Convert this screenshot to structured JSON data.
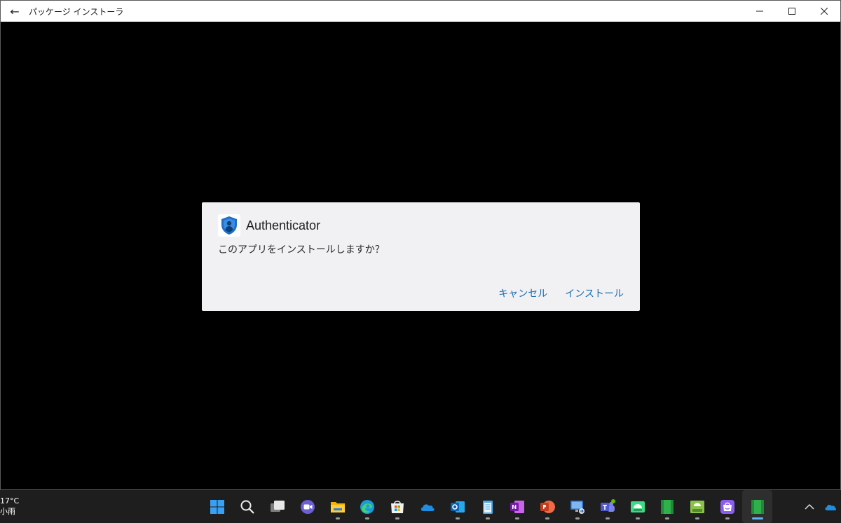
{
  "window": {
    "title": "パッケージ インストーラ",
    "back_glyph": "←",
    "minimize_glyph": "—",
    "maximize_glyph": "☐",
    "close_glyph": "✕"
  },
  "dialog": {
    "app_name": "Authenticator",
    "message": "このアプリをインストールしますか？",
    "cancel_label": "キャンセル",
    "install_label": "インストール"
  },
  "weather": {
    "temperature": "17°C",
    "condition": "小雨"
  },
  "taskbar": {
    "items": [
      {
        "name": "start-icon",
        "active": false,
        "running": false
      },
      {
        "name": "search-icon",
        "active": false,
        "running": false
      },
      {
        "name": "task-view-icon",
        "active": false,
        "running": false
      },
      {
        "name": "chat-icon",
        "active": false,
        "running": false
      },
      {
        "name": "file-explorer-icon",
        "active": false,
        "running": true
      },
      {
        "name": "edge-browser-icon",
        "active": false,
        "running": true
      },
      {
        "name": "microsoft-store-icon",
        "active": false,
        "running": true
      },
      {
        "name": "onedrive-icon",
        "active": false,
        "running": false
      },
      {
        "name": "outlook-icon",
        "active": false,
        "running": true
      },
      {
        "name": "notepad-icon",
        "active": false,
        "running": true
      },
      {
        "name": "onenote-icon",
        "active": false,
        "running": true
      },
      {
        "name": "powerpoint-icon",
        "active": false,
        "running": true
      },
      {
        "name": "remote-desktop-icon",
        "active": false,
        "running": true
      },
      {
        "name": "teams-icon",
        "active": false,
        "running": true
      },
      {
        "name": "android-icon",
        "active": false,
        "running": true
      },
      {
        "name": "green-app-icon",
        "active": false,
        "running": true
      },
      {
        "name": "apk-installer-icon",
        "active": false,
        "running": true
      },
      {
        "name": "amazon-appstore-icon",
        "active": false,
        "running": true
      },
      {
        "name": "package-installer-icon",
        "active": true,
        "running": true
      }
    ]
  },
  "tray": {
    "chevron_glyph": "^"
  },
  "colors": {
    "accent": "#1a6fb0",
    "dialog_bg": "#f1f0f3",
    "taskbar_bg": "#1e1e1e"
  }
}
